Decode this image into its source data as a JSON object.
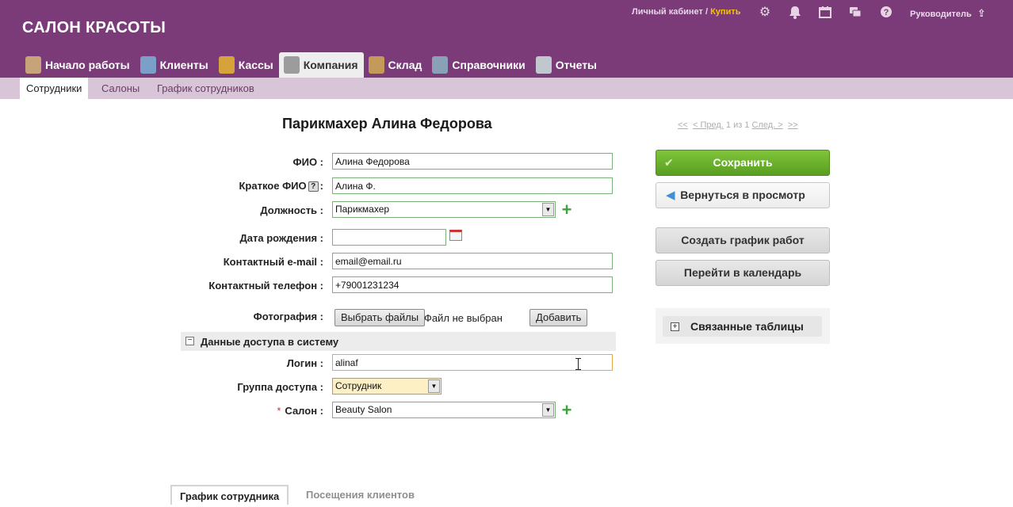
{
  "header": {
    "brand": "САЛОН КРАСОТЫ",
    "account_link": "Личный кабинет /",
    "buy_link": "Купить",
    "user": "Руководитель",
    "icons": [
      "gear-icon",
      "bell-icon",
      "calendar-icon",
      "chat-icon",
      "help-icon",
      "exit-icon"
    ]
  },
  "nav": {
    "tabs": [
      {
        "label": "Начало работы",
        "icon": "start-icon",
        "color": "#c7a37a"
      },
      {
        "label": "Клиенты",
        "icon": "clients-icon",
        "color": "#7aa0c9"
      },
      {
        "label": "Кассы",
        "icon": "cash-icon",
        "color": "#d6a23c"
      },
      {
        "label": "Компания",
        "icon": "company-gears-icon",
        "color": "#9c9c9c",
        "active": true
      },
      {
        "label": "Склад",
        "icon": "warehouse-box-icon",
        "color": "#c49a5a"
      },
      {
        "label": "Справочники",
        "icon": "reference-book-icon",
        "color": "#8aa0b6"
      },
      {
        "label": "Отчеты",
        "icon": "reports-icon",
        "color": "#c1c7cf"
      }
    ]
  },
  "subnav": {
    "tabs": [
      "Сотрудники",
      "Салоны",
      "График сотрудников"
    ]
  },
  "page": {
    "title": "Парикмахер Алина Федорова",
    "pager": {
      "first": "<<",
      "prev": "< Пред.",
      "middle": "1 из 1",
      "next": "След. >",
      "last": ">>"
    }
  },
  "form": {
    "fio_label": "ФИО :",
    "fio_value": "Алина Федорова",
    "short_fio_label": "Краткое ФИО",
    "short_fio_suffix": ":",
    "short_fio_value": "Алина Ф.",
    "position_label": "Должность :",
    "position_value": "Парикмахер",
    "birthdate_label": "Дата рождения :",
    "birthdate_value": "",
    "email_label": "Контактный e-mail :",
    "email_value": "email@email.ru",
    "phone_label": "Контактный телефон :",
    "phone_value": "+79001231234",
    "photo_label": "Фотография :",
    "choose_files": "Выбрать файлы",
    "no_file": "Файл не выбран",
    "add_button": "Добавить",
    "access_section": "Данные доступа в систему",
    "login_label": "Логин :",
    "login_value": "alinaf",
    "group_label": "Группа доступа :",
    "group_value": "Сотрудник",
    "salon_label": "Салон :",
    "salon_required_mark": "*",
    "salon_value": "Beauty Salon"
  },
  "actions": {
    "save": "Сохранить",
    "back": "Вернуться в просмотр",
    "create_schedule": "Создать график работ",
    "go_calendar": "Перейти в календарь",
    "related_tables": "Связанные таблицы"
  },
  "bottom_tabs": [
    "График сотрудника",
    "Посещения клиентов"
  ]
}
